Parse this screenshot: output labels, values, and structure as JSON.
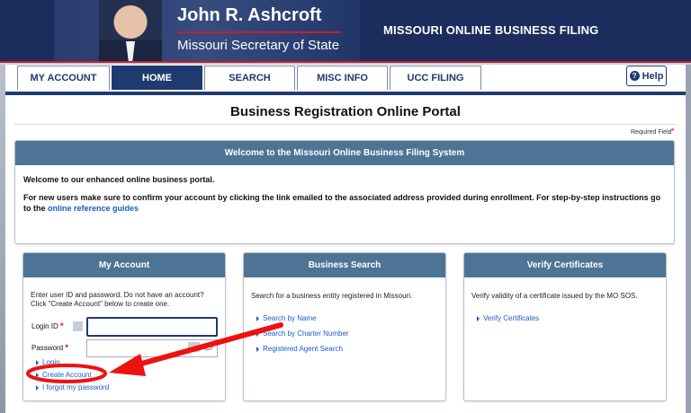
{
  "header": {
    "name": "John R. Ashcroft",
    "office": "Missouri Secretary of State",
    "site_title": "MISSOURI ONLINE BUSINESS FILING"
  },
  "tabs": [
    {
      "label": "MY ACCOUNT",
      "active": false
    },
    {
      "label": "HOME",
      "active": true
    },
    {
      "label": "SEARCH",
      "active": false
    },
    {
      "label": "MISC INFO",
      "active": false
    },
    {
      "label": "UCC FILING",
      "active": false
    }
  ],
  "help_label": "Help",
  "portal_title": "Business Registration Online Portal",
  "required_field": "Required Field",
  "welcome": {
    "heading": "Welcome to the Missouri Online Business Filing System",
    "line1": "Welcome to our enhanced online business portal.",
    "line2": "For new users make sure to confirm your account by clicking the link emailed to the associated address provided during enrollment. For step-by-step instructions go to the",
    "link": "online reference guides"
  },
  "my_account": {
    "heading": "My Account",
    "desc": "Enter user ID and password. Do not have an account? Click \"Create Account\" below to create one.",
    "login_id_label": "Login ID",
    "password_label": "Password",
    "links": [
      "Login",
      "Create Account",
      "I forgot my password"
    ]
  },
  "business_search": {
    "heading": "Business Search",
    "desc": "Search for a business entity registered in Missouri.",
    "links": [
      "Search by Name",
      "Search by Charter Number",
      "Registered Agent Search"
    ]
  },
  "verify": {
    "heading": "Verify Certificates",
    "desc": "Verify validity of a certificate issued by the MO SOS.",
    "links": [
      "Verify Certificates"
    ]
  },
  "colors": {
    "navy": "#1f3a6e",
    "panel_header": "#4d7494",
    "link": "#1a5dc2",
    "annotation_red": "#ee1111"
  }
}
